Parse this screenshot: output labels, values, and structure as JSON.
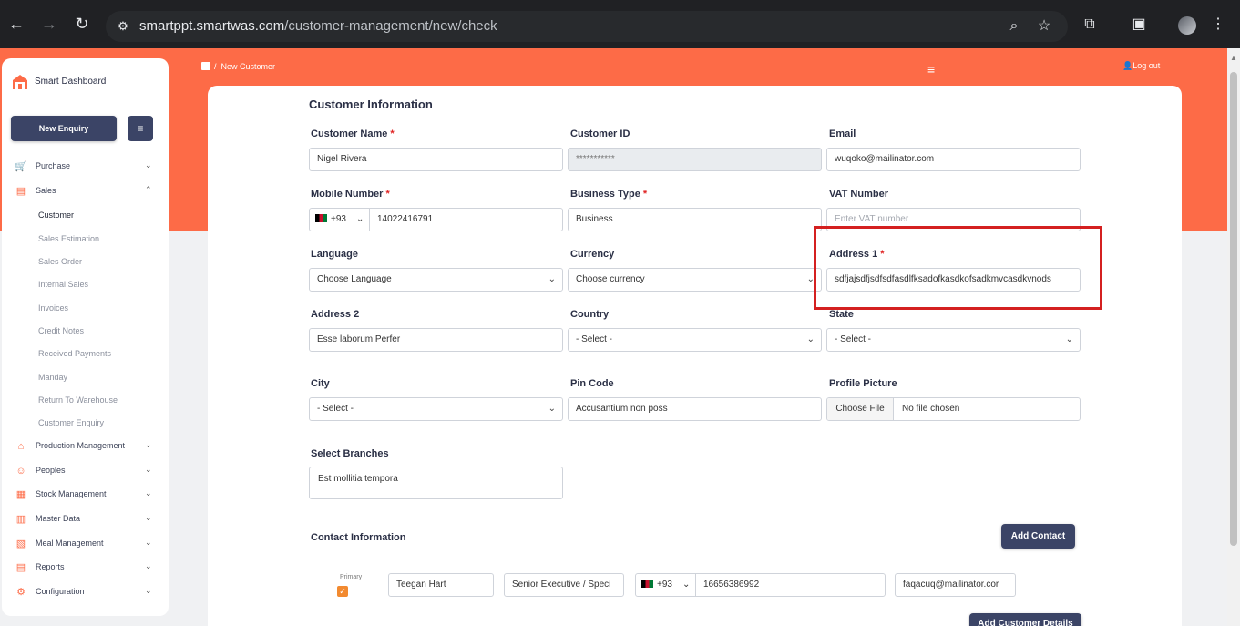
{
  "browser": {
    "url_host": "smartppt.smartwas.com",
    "url_path": "/customer-management/new/check"
  },
  "sidebar": {
    "brand": "Smart Dashboard",
    "new_enquiry": "New Enquiry",
    "items": [
      {
        "label": "Purchase",
        "icon": "cart-icon"
      },
      {
        "label": "Sales",
        "icon": "sales-icon"
      },
      {
        "label": "Production Management",
        "icon": "factory-icon"
      },
      {
        "label": "Peoples",
        "icon": "people-icon"
      },
      {
        "label": "Stock Management",
        "icon": "stock-icon"
      },
      {
        "label": "Master Data",
        "icon": "database-icon"
      },
      {
        "label": "Meal Management",
        "icon": "meal-icon"
      },
      {
        "label": "Reports",
        "icon": "reports-icon"
      },
      {
        "label": "Configuration",
        "icon": "config-icon"
      }
    ],
    "sales_sub": [
      "Customer",
      "Sales Estimation",
      "Sales Order",
      "Internal Sales",
      "Invoices",
      "Credit Notes",
      "Received Payments",
      "Manday",
      "Return To Warehouse",
      "Customer Enquiry"
    ]
  },
  "topbar": {
    "breadcrumb": "New Customer",
    "logout": "Log out"
  },
  "form": {
    "title": "Customer Information",
    "customer_name_label": "Customer Name",
    "customer_name": "Nigel Rivera",
    "customer_id_label": "Customer ID",
    "customer_id": "***********",
    "email_label": "Email",
    "email": "wuqoko@mailinator.com",
    "mobile_label": "Mobile Number",
    "mobile_code": "+93",
    "mobile": "14022416791",
    "business_type_label": "Business Type",
    "business_type": "Business",
    "vat_label": "VAT Number",
    "vat_placeholder": "Enter VAT number",
    "language_label": "Language",
    "language": "Choose Language",
    "currency_label": "Currency",
    "currency": "Choose currency",
    "address1_label": "Address 1",
    "address1": "sdfjajsdfjsdfsdfasdlfksadofkasdkofsadkmvcasdkvnods",
    "address2_label": "Address 2",
    "address2": "Esse laborum Perfer",
    "country_label": "Country",
    "country": "- Select -",
    "state_label": "State",
    "state": "- Select -",
    "city_label": "City",
    "city": "- Select -",
    "pin_label": "Pin Code",
    "pin": "Accusantium non poss",
    "profile_label": "Profile Picture",
    "choose_file": "Choose File",
    "no_file": "No file chosen",
    "branches_label": "Select Branches",
    "branches": "Est mollitia tempora",
    "required_mark": "*"
  },
  "contact": {
    "title": "Contact Information",
    "add_button": "Add Contact",
    "primary_label": "Primary",
    "name": "Teegan Hart",
    "designation": "Senior Executive / Speci",
    "code": "+93",
    "phone": "16656386992",
    "email": "faqacuq@mailinator.cor",
    "add_details_button": "Add Customer Details"
  }
}
